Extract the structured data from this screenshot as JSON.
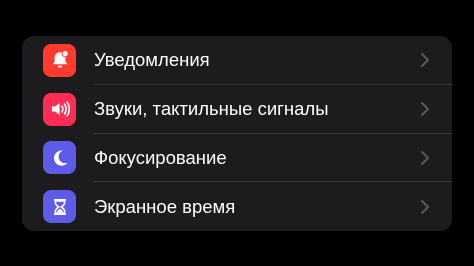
{
  "settings": {
    "items": [
      {
        "label": "Уведомления",
        "icon": "notifications-bell-icon",
        "color": "#ff3b30"
      },
      {
        "label": "Звуки, тактильные сигналы",
        "icon": "speaker-sound-icon",
        "color": "#ff2d55"
      },
      {
        "label": "Фокусирование",
        "icon": "moon-icon",
        "color": "#5e5ce6"
      },
      {
        "label": "Экранное время",
        "icon": "hourglass-icon",
        "color": "#5e5ce6"
      }
    ]
  },
  "colors": {
    "background": "#000000",
    "group_background": "#1c1c1e",
    "separator": "#38383a",
    "chevron": "#5a5a5e",
    "text": "#ffffff"
  }
}
